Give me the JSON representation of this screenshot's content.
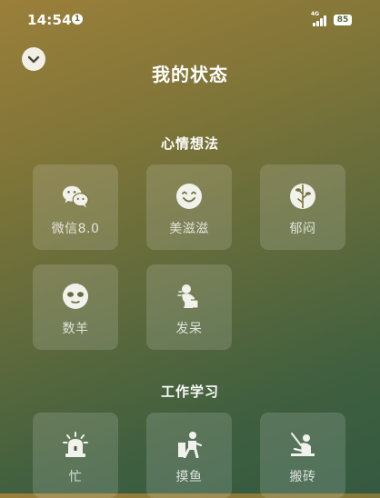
{
  "status_bar": {
    "time": "14:54",
    "notification_count": "1",
    "network_type": "4G",
    "battery_level": "85"
  },
  "header": {
    "title": "我的状态",
    "collapse_icon": "chevron-down-icon"
  },
  "sections": [
    {
      "title": "心情想法",
      "items": [
        {
          "label": "微信8.0",
          "icon": "wechat-icon"
        },
        {
          "label": "美滋滋",
          "icon": "smile-face-icon"
        },
        {
          "label": "郁闷",
          "icon": "gloomy-face-icon"
        },
        {
          "label": "数羊",
          "icon": "sheep-face-icon"
        },
        {
          "label": "发呆",
          "icon": "daze-person-icon"
        }
      ]
    },
    {
      "title": "工作学习",
      "items": [
        {
          "label": "忙",
          "icon": "siren-icon"
        },
        {
          "label": "摸鱼",
          "icon": "slacking-person-icon"
        },
        {
          "label": "搬砖",
          "icon": "brick-worker-icon"
        }
      ]
    }
  ],
  "colors": {
    "background_top": "#9b7f3a",
    "background_bottom": "#345a41",
    "tile": "rgba(255,255,255,0.14)",
    "icon": "#f2f2ec"
  }
}
